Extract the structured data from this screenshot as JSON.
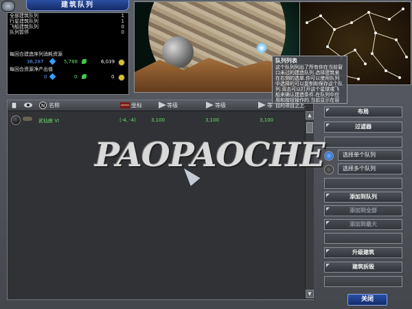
{
  "window": {
    "title": "建筑队列"
  },
  "stats": {
    "rows": [
      {
        "label": "全部建筑队列",
        "value": "1"
      },
      {
        "label": "行星建筑队列",
        "value": "1"
      },
      {
        "label": "飞船建筑队列",
        "value": "0"
      },
      {
        "label": "队列暂停",
        "value": "0"
      }
    ],
    "consume_header": "每回合建造序列消耗资源",
    "consume": {
      "crystal": "36,287",
      "plant": "5,788",
      "radioactive": "6,039"
    },
    "net_header": "每回合资源净产出值",
    "net": {
      "crystal": "0",
      "plant": "0",
      "radioactive": "0"
    }
  },
  "tooltip": {
    "title": "队列列表",
    "body": "这个队列列出了所有你在当前窗口未过的建造队列.选择建筑来在右侧的选单.你可以使用队列中选择的可以复制和保存这个队列.双击可以打开这个星球或飞船来确认建造条件.在队列中应用和按钮操作的.当前显示在容目的项目之上."
  },
  "list": {
    "headers": {
      "name": "名称",
      "coord": "坐标",
      "level1": "等级",
      "level2": "等级",
      "level3": "等"
    },
    "rows": [
      {
        "name": "武仙座 VI",
        "coord": "(-4, -4)",
        "v1": "3,100",
        "v2": "3,100",
        "v3": "3,100"
      }
    ]
  },
  "watermark": "PAOPAOCHE",
  "right_panel": {
    "layout": "布局",
    "filter": "过滤器",
    "select_single": "选择单个队列",
    "select_multi": "选择多个队列",
    "add_to_queue": "添加到队列",
    "add_to_all": "添加到全部",
    "add_to_max": "添加到最大",
    "upgrade": "升级建筑",
    "demolish": "建筑拆毁"
  },
  "footer": {
    "close": "关闭"
  },
  "colors": {
    "accent": "#2b4fa5",
    "green_text": "#6fe06c",
    "crystal_blue": "#5ea6ff"
  }
}
